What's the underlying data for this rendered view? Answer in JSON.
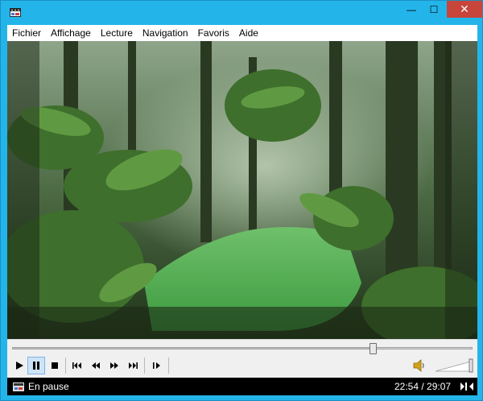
{
  "window": {
    "controls": {
      "minimize": "—",
      "maximize": "☐",
      "close": "✕"
    }
  },
  "menu": [
    {
      "label": "Fichier"
    },
    {
      "label": "Affichage"
    },
    {
      "label": "Lecture"
    },
    {
      "label": "Navigation"
    },
    {
      "label": "Favoris"
    },
    {
      "label": "Aide"
    }
  ],
  "playback": {
    "progress_fraction": 0.785,
    "volume_fraction": 1.0,
    "buttons": [
      {
        "name": "play-button",
        "icon": "play-icon",
        "glyph": "▶"
      },
      {
        "name": "pause-button",
        "icon": "pause-icon",
        "glyph": "❚❚",
        "active": true
      },
      {
        "name": "stop-button",
        "icon": "stop-icon",
        "glyph": "■"
      },
      {
        "name": "previous-button",
        "icon": "skip-back-icon",
        "glyph": "⏮"
      },
      {
        "name": "rewind-button",
        "icon": "rewind-icon",
        "glyph": "◀◀"
      },
      {
        "name": "fast-forward-button",
        "icon": "fast-forward-icon",
        "glyph": "▶▶"
      },
      {
        "name": "next-button",
        "icon": "skip-forward-icon",
        "glyph": "⏭"
      },
      {
        "name": "frame-step-button",
        "icon": "frame-step-icon",
        "glyph": "❙▶"
      }
    ]
  },
  "status": {
    "state": "En pause",
    "elapsed": "22:54",
    "duration": "29:07"
  },
  "colors": {
    "title_bar": "#23b5ea",
    "close_button": "#c7453b",
    "active_button": "#cde4f7",
    "status_bar": "#000000"
  }
}
